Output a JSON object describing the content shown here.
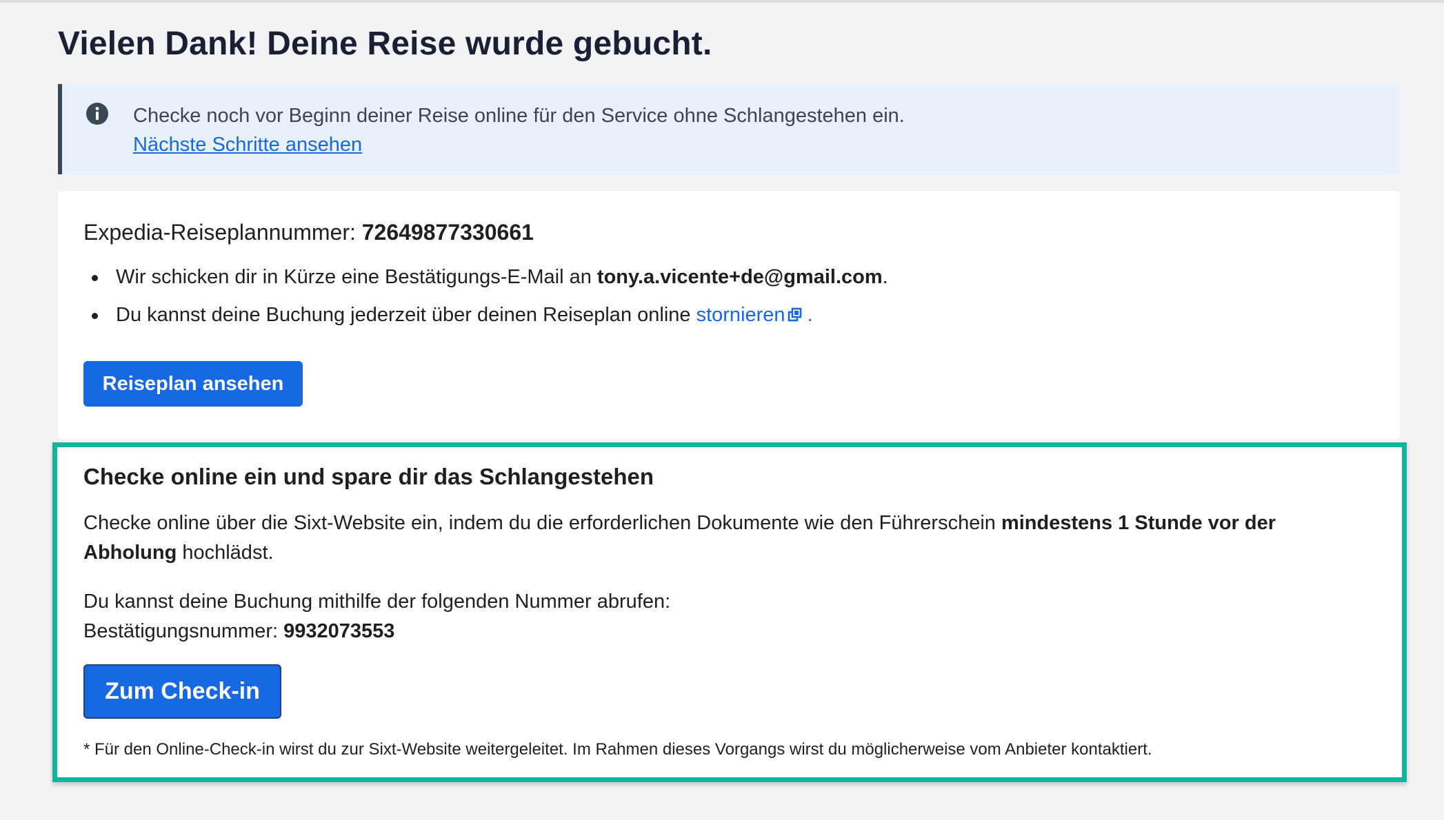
{
  "page": {
    "title": "Vielen Dank! Deine Reise wurde gebucht."
  },
  "info_banner": {
    "icon": "info-icon",
    "text": "Checke noch vor Beginn deiner Reise online für den Service ohne Schlangestehen ein.",
    "link_label": "Nächste Schritte ansehen"
  },
  "itinerary": {
    "label": "Expedia-Reiseplannummer: ",
    "number": "72649877330661",
    "bullet1_prefix": "Wir schicken dir in Kürze eine Bestätigungs-E-Mail an ",
    "email": "tony.a.vicente+de@gmail.com",
    "bullet1_suffix": ".",
    "bullet2_prefix": "Du kannst deine Buchung jederzeit über deinen Reiseplan online ",
    "cancel_link_label": "stornieren",
    "cancel_link_icon": "external-link-icon",
    "bullet2_suffix": " .",
    "button_label": "Reiseplan ansehen"
  },
  "checkin": {
    "title": "Checke online ein und spare dir das Schlangestehen",
    "desc_prefix": "Checke online über die Sixt-Website ein, indem du die erforderlichen Dokumente wie den Führerschein ",
    "desc_bold": "mindestens 1 Stunde vor der Abholung",
    "desc_suffix": " hochlädst.",
    "lookup_text": "Du kannst deine Buchung mithilfe der folgenden Nummer abrufen:",
    "confirmation_label": "Bestätigungsnummer: ",
    "confirmation_number": "9932073553",
    "button_label": "Zum Check-in",
    "footnote": "* Für den Online-Check-in wirst du zur Sixt-Website weitergeleitet. Im Rahmen dieses Vorgangs wirst du möglicherweise vom Anbieter kontaktiert."
  },
  "colors": {
    "background": "#f3f3f5",
    "accent_blue": "#1668e3",
    "banner_bg": "#e7f0fb",
    "highlight_border": "#12b59b",
    "title_text": "#1a1f36"
  }
}
